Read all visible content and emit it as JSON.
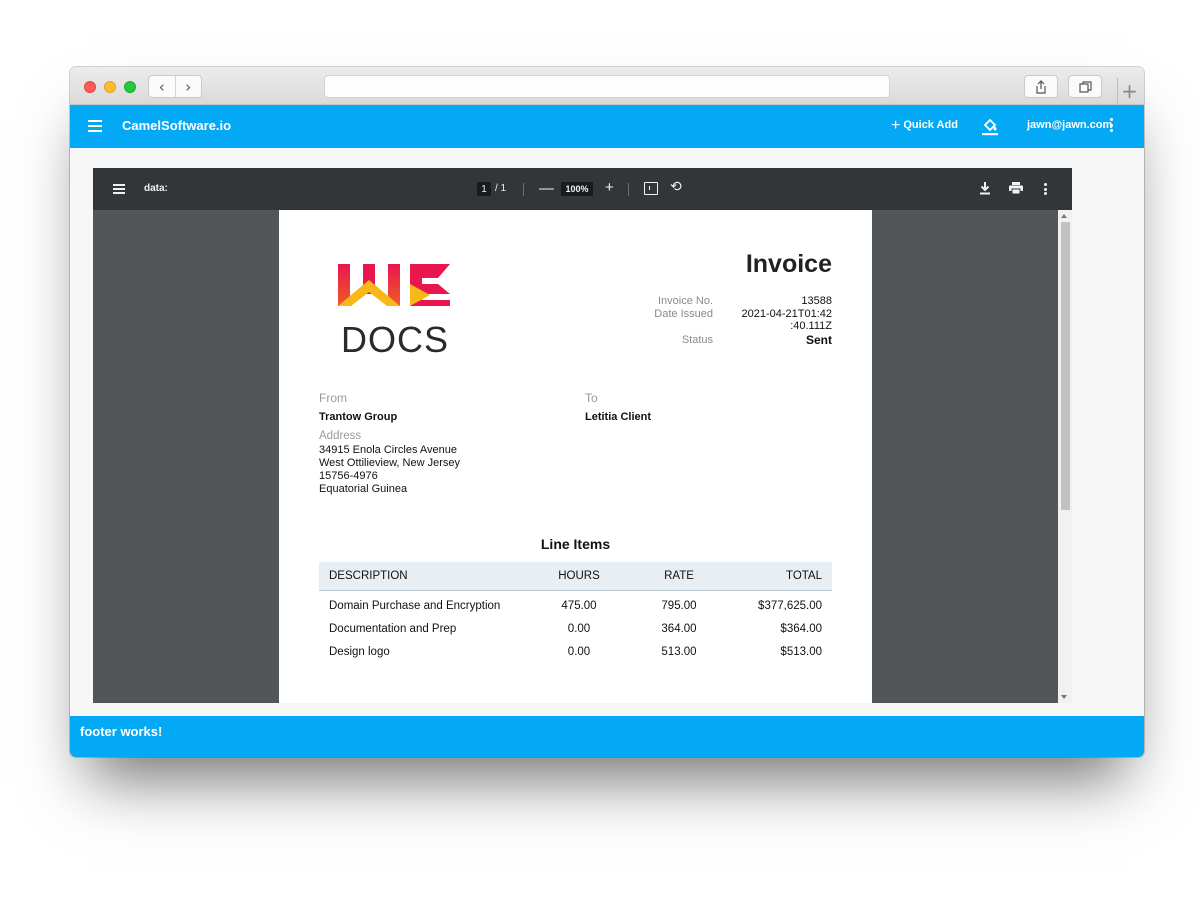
{
  "app": {
    "brand": "CamelSoftware.io",
    "quick_add_label": "Quick Add",
    "user_email": "jawn@jawn.com",
    "accent_color": "#03a9f4"
  },
  "pdf_viewer": {
    "title": "data:",
    "current_page": "1",
    "page_separator": "/ 1",
    "zoom": "100%"
  },
  "invoice": {
    "logo_text": "DOCS",
    "title": "Invoice",
    "invoice_no_label": "Invoice No.",
    "invoice_no": "13588",
    "date_issued_label": "Date Issued",
    "date_issued_line1": "2021-04-21T01:42",
    "date_issued_line2": ":40.111Z",
    "status_label": "Status",
    "status": "Sent",
    "status_color": "#14a114",
    "from_label": "From",
    "from_name": "Trantow Group",
    "address_label": "Address",
    "address_lines": [
      "34915 Enola Circles Avenue",
      "West Ottilieview, New Jersey",
      "15756-4976",
      "Equatorial Guinea"
    ],
    "to_label": "To",
    "to_name": "Letitia Client",
    "line_items_title": "Line Items",
    "columns": [
      "DESCRIPTION",
      "HOURS",
      "RATE",
      "TOTAL"
    ],
    "rows": [
      [
        "Domain Purchase and Encryption",
        "475.00",
        "795.00",
        "$377,625.00"
      ],
      [
        "Documentation and Prep",
        "0.00",
        "364.00",
        "$364.00"
      ],
      [
        "Design logo",
        "0.00",
        "513.00",
        "$513.00"
      ]
    ]
  },
  "footer": {
    "text": "footer works!"
  }
}
